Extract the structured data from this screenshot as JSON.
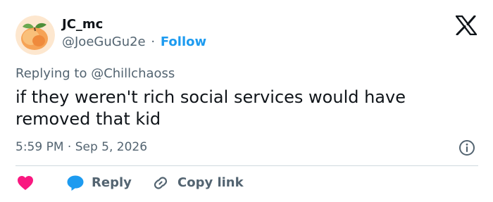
{
  "author": {
    "display_name": "JC_mc",
    "handle": "@JoeGuGu2e",
    "separator": "·",
    "follow_label": "Follow",
    "avatar_icon": "peach-avatar"
  },
  "platform_logo": "x-logo-icon",
  "reply_context": "Replying to @Chillchaoss",
  "tweet": {
    "text": "if they weren't rich social services would have removed that kid"
  },
  "meta": {
    "timestamp": "5:59 PM · Sep 5, 2026"
  },
  "actions": {
    "like_icon": "heart-icon",
    "reply_label": "Reply",
    "copy_link_label": "Copy link"
  },
  "colors": {
    "accent": "#1d9bf0",
    "like": "#f91880",
    "muted_text": "#536471",
    "primary_text": "#0f1419",
    "divider": "#cfd9de"
  }
}
